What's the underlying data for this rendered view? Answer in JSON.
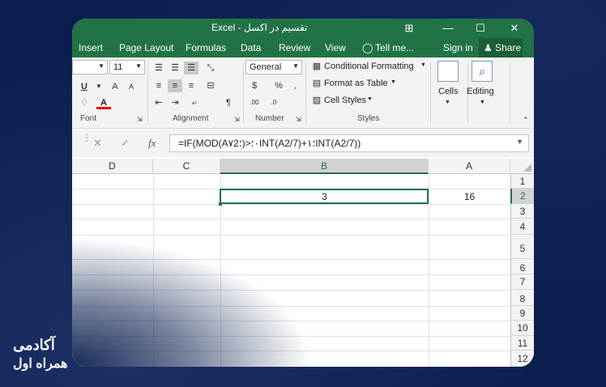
{
  "window": {
    "title": "تقسیم در اکسل - Excel",
    "controls": {
      "ribbon_display": "⊞",
      "minimize": "—",
      "maximize": "☐",
      "close": "✕"
    }
  },
  "menubar": {
    "items": [
      "Insert",
      "Page Layout",
      "Formulas",
      "Data",
      "Review",
      "View"
    ],
    "tell_me": "Tell me...",
    "sign_in": "Sign in",
    "share": "Share"
  },
  "ribbon": {
    "font": {
      "label": "Font",
      "font_name": "",
      "font_size": "11",
      "underline": "U",
      "grow": "A",
      "shrink": "A",
      "font_color": "A"
    },
    "alignment": {
      "label": "Alignment"
    },
    "number": {
      "label": "Number",
      "format": "General",
      "currency": "$",
      "percent": "%",
      "comma": ","
    },
    "styles": {
      "label": "Styles",
      "conditional_formatting": "Conditional Formatting",
      "format_as_table": "Format as Table",
      "cell_styles": "Cell Styles"
    },
    "cells": {
      "label": "Cells"
    },
    "editing": {
      "label": "Editing"
    }
  },
  "formula_bar": {
    "cancel": "✕",
    "enter": "✓",
    "fx": "fx",
    "formula": "=IF(MOD(A۷؛2)>۰؛INT(A2/7)+۱؛INT(A2/7))"
  },
  "sheet": {
    "columns": [
      "D",
      "C",
      "B",
      "A"
    ],
    "selected_column": "B",
    "rows": [
      "1",
      "2",
      "3",
      "4",
      "5",
      "6",
      "7",
      "8",
      "9",
      "10",
      "11",
      "12"
    ],
    "selected_row": "2",
    "cells": {
      "B2": "3",
      "A2": "16"
    }
  },
  "brand": {
    "line1": "آکادمی",
    "line2": "همراه اول"
  },
  "colors": {
    "excel_green": "#217346",
    "background": "#0b1f4f"
  }
}
